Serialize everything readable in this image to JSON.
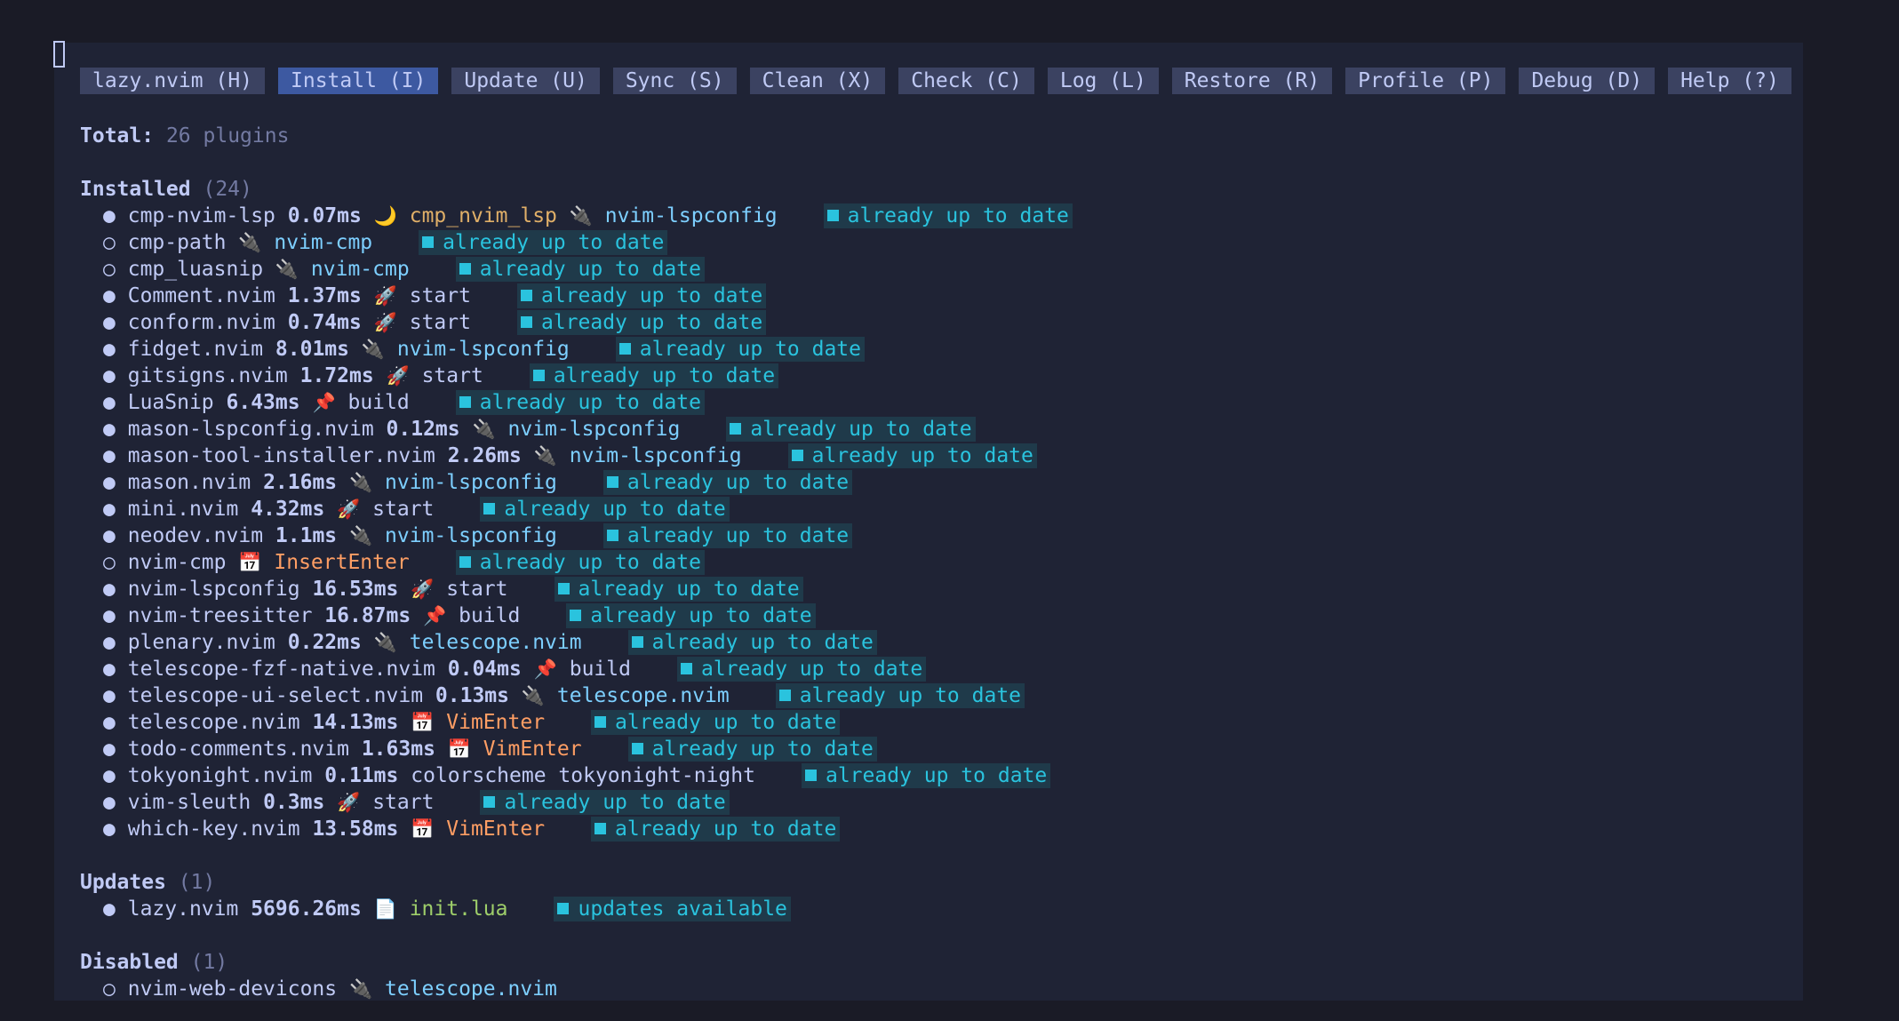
{
  "tabs": [
    {
      "label": "lazy.nvim (H)",
      "active": false
    },
    {
      "label": "Install (I)",
      "active": true
    },
    {
      "label": "Update (U)",
      "active": false
    },
    {
      "label": "Sync (S)",
      "active": false
    },
    {
      "label": "Clean (X)",
      "active": false
    },
    {
      "label": "Check (C)",
      "active": false
    },
    {
      "label": "Log (L)",
      "active": false
    },
    {
      "label": "Restore (R)",
      "active": false
    },
    {
      "label": "Profile (P)",
      "active": false
    },
    {
      "label": "Debug (D)",
      "active": false
    },
    {
      "label": "Help (?)",
      "active": false
    }
  ],
  "total": {
    "label": "Total:",
    "value": "26 plugins"
  },
  "sections": [
    {
      "title": "Installed",
      "count": "(24)",
      "items": [
        {
          "loaded": true,
          "name": "cmp-nvim-lsp",
          "time": "0.07ms",
          "icon": "ft-icon",
          "trigger": "cmp_nvim_lsp",
          "trigger_type": "ft",
          "extra_icon": "plug-icon",
          "extra": "nvim-lspconfig",
          "status": "already up to date"
        },
        {
          "loaded": false,
          "name": "cmp-path",
          "time": "",
          "icon": "plug-icon",
          "trigger": "nvim-cmp",
          "trigger_type": "plugin",
          "status": "already up to date"
        },
        {
          "loaded": false,
          "name": "cmp_luasnip",
          "time": "",
          "icon": "plug-icon",
          "trigger": "nvim-cmp",
          "trigger_type": "plugin",
          "status": "already up to date"
        },
        {
          "loaded": true,
          "name": "Comment.nvim",
          "time": "1.37ms",
          "icon": "rocket-icon",
          "trigger": "start",
          "trigger_type": "start",
          "status": "already up to date"
        },
        {
          "loaded": true,
          "name": "conform.nvim",
          "time": "0.74ms",
          "icon": "rocket-icon",
          "trigger": "start",
          "trigger_type": "start",
          "status": "already up to date"
        },
        {
          "loaded": true,
          "name": "fidget.nvim",
          "time": "8.01ms",
          "icon": "plug-icon",
          "trigger": "nvim-lspconfig",
          "trigger_type": "plugin",
          "status": "already up to date"
        },
        {
          "loaded": true,
          "name": "gitsigns.nvim",
          "time": "1.72ms",
          "icon": "rocket-icon",
          "trigger": "start",
          "trigger_type": "start",
          "status": "already up to date"
        },
        {
          "loaded": true,
          "name": "LuaSnip",
          "time": "6.43ms",
          "icon": "pin-icon",
          "trigger": "build",
          "trigger_type": "build",
          "status": "already up to date"
        },
        {
          "loaded": true,
          "name": "mason-lspconfig.nvim",
          "time": "0.12ms",
          "icon": "plug-icon",
          "trigger": "nvim-lspconfig",
          "trigger_type": "plugin",
          "status": "already up to date"
        },
        {
          "loaded": true,
          "name": "mason-tool-installer.nvim",
          "time": "2.26ms",
          "icon": "plug-icon",
          "trigger": "nvim-lspconfig",
          "trigger_type": "plugin",
          "status": "already up to date"
        },
        {
          "loaded": true,
          "name": "mason.nvim",
          "time": "2.16ms",
          "icon": "plug-icon",
          "trigger": "nvim-lspconfig",
          "trigger_type": "plugin",
          "status": "already up to date"
        },
        {
          "loaded": true,
          "name": "mini.nvim",
          "time": "4.32ms",
          "icon": "rocket-icon",
          "trigger": "start",
          "trigger_type": "start",
          "status": "already up to date"
        },
        {
          "loaded": true,
          "name": "neodev.nvim",
          "time": "1.1ms",
          "icon": "plug-icon",
          "trigger": "nvim-lspconfig",
          "trigger_type": "plugin",
          "status": "already up to date"
        },
        {
          "loaded": false,
          "name": "nvim-cmp",
          "time": "",
          "icon": "calendar-icon",
          "trigger": "InsertEnter",
          "trigger_type": "event",
          "status": "already up to date"
        },
        {
          "loaded": true,
          "name": "nvim-lspconfig",
          "time": "16.53ms",
          "icon": "rocket-icon",
          "trigger": "start",
          "trigger_type": "start",
          "status": "already up to date"
        },
        {
          "loaded": true,
          "name": "nvim-treesitter",
          "time": "16.87ms",
          "icon": "pin-icon",
          "trigger": "build",
          "trigger_type": "build",
          "status": "already up to date"
        },
        {
          "loaded": true,
          "name": "plenary.nvim",
          "time": "0.22ms",
          "icon": "plug-icon",
          "trigger": "telescope.nvim",
          "trigger_type": "plugin",
          "status": "already up to date"
        },
        {
          "loaded": true,
          "name": "telescope-fzf-native.nvim",
          "time": "0.04ms",
          "icon": "pin-icon",
          "trigger": "build",
          "trigger_type": "build",
          "status": "already up to date"
        },
        {
          "loaded": true,
          "name": "telescope-ui-select.nvim",
          "time": "0.13ms",
          "icon": "plug-icon",
          "trigger": "telescope.nvim",
          "trigger_type": "plugin",
          "status": "already up to date"
        },
        {
          "loaded": true,
          "name": "telescope.nvim",
          "time": "14.13ms",
          "icon": "calendar-icon",
          "trigger": "VimEnter",
          "trigger_type": "event",
          "status": "already up to date"
        },
        {
          "loaded": true,
          "name": "todo-comments.nvim",
          "time": "1.63ms",
          "icon": "calendar-icon",
          "trigger": "VimEnter",
          "trigger_type": "event",
          "status": "already up to date"
        },
        {
          "loaded": true,
          "name": "tokyonight.nvim",
          "time": "0.11ms",
          "icon": "",
          "trigger": "colorscheme tokyonight-night",
          "trigger_type": "cs",
          "status": "already up to date"
        },
        {
          "loaded": true,
          "name": "vim-sleuth",
          "time": "0.3ms",
          "icon": "rocket-icon",
          "trigger": "start",
          "trigger_type": "start",
          "status": "already up to date"
        },
        {
          "loaded": true,
          "name": "which-key.nvim",
          "time": "13.58ms",
          "icon": "calendar-icon",
          "trigger": "VimEnter",
          "trigger_type": "event",
          "status": "already up to date"
        }
      ]
    },
    {
      "title": "Updates",
      "count": "(1)",
      "items": [
        {
          "loaded": true,
          "name": "lazy.nvim",
          "time": "5696.26ms",
          "icon": "file-icon",
          "trigger": "init.lua",
          "trigger_type": "source",
          "status": "updates available"
        }
      ]
    },
    {
      "title": "Disabled",
      "count": "(1)",
      "items": [
        {
          "loaded": false,
          "name": "nvim-web-devicons",
          "time": "",
          "icon": "plug-icon",
          "trigger": "telescope.nvim",
          "trigger_type": "plugin",
          "status": ""
        }
      ]
    }
  ],
  "colors": {
    "background": "#1a1b26",
    "panel": "#1f2335",
    "accent": "#2ac3de",
    "event": "#ff9e64",
    "plugin": "#7dcfff",
    "source": "#9ece6a"
  }
}
